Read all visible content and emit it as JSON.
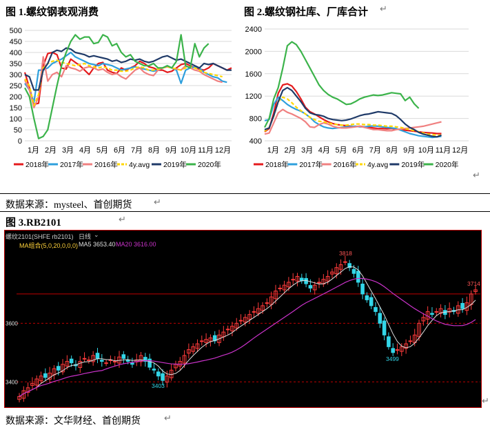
{
  "fig1": {
    "title": "图 1.螺纹钢表观消费",
    "months": [
      "1月",
      "2月",
      "3月",
      "4月",
      "5月",
      "6月",
      "7月",
      "8月",
      "9月",
      "10月",
      "11月",
      "12月"
    ],
    "yticks": [
      "0",
      "50",
      "100",
      "150",
      "200",
      "250",
      "300",
      "350",
      "400",
      "450",
      "500"
    ],
    "series": [
      {
        "name": "2018年",
        "color": "#e41a1c",
        "dash": "",
        "values": [
          310,
          240,
          165,
          170,
          340,
          395,
          400,
          390,
          330,
          325,
          370,
          355,
          340,
          320,
          300,
          330,
          350,
          355,
          320,
          310,
          305,
          330,
          320,
          330,
          340,
          360,
          350,
          335,
          330,
          320,
          320,
          310,
          315,
          330,
          345,
          350,
          340,
          330,
          325,
          320,
          330,
          350,
          340,
          330,
          320,
          330
        ]
      },
      {
        "name": "2017年",
        "color": "#2e9fdc",
        "dash": "",
        "values": [
          260,
          230,
          175,
          320,
          320,
          330,
          350,
          360,
          370,
          385,
          400,
          380,
          370,
          360,
          350,
          345,
          340,
          350,
          345,
          340,
          330,
          320,
          325,
          330,
          335,
          330,
          325,
          320,
          315,
          320,
          330,
          340,
          330,
          320,
          260,
          320,
          330,
          335,
          330,
          310,
          300,
          290,
          285,
          270,
          265
        ]
      },
      {
        "name": "2016年",
        "color": "#f08080",
        "dash": "",
        "values": [
          275,
          230,
          150,
          200,
          380,
          270,
          300,
          310,
          290,
          340,
          330,
          325,
          315,
          330,
          335,
          330,
          320,
          325,
          310,
          300,
          305,
          290,
          280,
          300,
          320,
          330,
          310,
          300,
          295,
          320,
          330,
          335,
          330,
          325,
          320,
          340,
          330,
          320,
          315,
          300,
          290,
          280,
          270,
          265
        ]
      },
      {
        "name": "4y.avg",
        "color": "#ffd700",
        "dash": "5,3",
        "values": [
          280,
          250,
          160,
          210,
          330,
          350,
          360,
          365,
          355,
          350,
          345,
          340,
          345,
          350,
          340,
          335,
          330,
          335,
          330,
          320,
          320,
          315,
          315,
          320,
          330,
          335,
          330,
          320,
          320,
          325,
          330,
          335,
          330,
          325,
          320,
          330,
          335,
          330,
          320,
          310,
          305,
          300,
          295,
          290
        ]
      },
      {
        "name": "2019年",
        "color": "#1f3a68",
        "dash": "",
        "values": [
          300,
          290,
          230,
          230,
          320,
          350,
          400,
          410,
          405,
          420,
          415,
          400,
          395,
          390,
          380,
          385,
          380,
          375,
          370,
          360,
          365,
          355,
          360,
          370,
          365,
          370,
          360,
          355,
          360,
          370,
          380,
          385,
          375,
          365,
          370,
          360,
          350,
          340,
          330,
          350,
          345,
          350,
          340,
          330,
          320,
          320
        ]
      },
      {
        "name": "2020年",
        "color": "#3bb34a",
        "dash": "",
        "values": [
          240,
          200,
          100,
          10,
          20,
          50,
          150,
          250,
          340,
          400,
          450,
          480,
          460,
          470,
          470,
          440,
          445,
          480,
          470,
          430,
          440,
          400,
          380,
          390,
          360,
          350,
          340,
          340,
          350,
          330,
          330,
          340,
          330,
          360,
          480,
          340,
          330,
          440,
          380,
          420,
          440
        ]
      }
    ]
  },
  "fig2": {
    "title": "图 2.螺纹钢社库、厂库合计",
    "months": [
      "1月",
      "2月",
      "3月",
      "4月",
      "5月",
      "6月",
      "7月",
      "8月",
      "9月",
      "10月",
      "11月",
      "12月"
    ],
    "yticks": [
      "400",
      "800",
      "1200",
      "1600",
      "2000",
      "2400"
    ],
    "series": [
      {
        "name": "2018年",
        "color": "#e41a1c",
        "dash": "",
        "values": [
          560,
          620,
          900,
          1250,
          1400,
          1420,
          1380,
          1280,
          1150,
          1000,
          920,
          880,
          830,
          780,
          740,
          710,
          690,
          680,
          670,
          660,
          655,
          660,
          650,
          640,
          630,
          620,
          620,
          615,
          620,
          610,
          600,
          590,
          580,
          570,
          560,
          550,
          545,
          540,
          530,
          530
        ]
      },
      {
        "name": "2017年",
        "color": "#2e9fdc",
        "dash": "",
        "values": [
          760,
          780,
          1050,
          1180,
          1120,
          1050,
          1000,
          960,
          930,
          880,
          820,
          740,
          690,
          650,
          630,
          620,
          630,
          640,
          650,
          655,
          660,
          650,
          650,
          660,
          665,
          660,
          650,
          640,
          630,
          620,
          590,
          560,
          530,
          510,
          490,
          480,
          470,
          460,
          470,
          480
        ]
      },
      {
        "name": "2016年",
        "color": "#f08080",
        "dash": "",
        "values": [
          520,
          540,
          720,
          900,
          960,
          910,
          880,
          840,
          800,
          740,
          650,
          640,
          690,
          720,
          700,
          660,
          640,
          630,
          630,
          640,
          650,
          660,
          640,
          620,
          600,
          600,
          590,
          580,
          580,
          600,
          610,
          620,
          630,
          640,
          650,
          660,
          680,
          700,
          720,
          740
        ]
      },
      {
        "name": "4y.avg",
        "color": "#ffd700",
        "dash": "5,3",
        "values": [
          570,
          640,
          840,
          1100,
          1180,
          1150,
          1080,
          1000,
          940,
          880,
          820,
          780,
          750,
          740,
          720,
          700,
          690,
          680,
          680,
          690,
          700,
          700,
          690,
          690,
          680,
          680,
          670,
          660,
          660,
          650,
          640,
          620,
          600,
          580,
          560,
          540,
          520,
          510,
          500,
          500
        ]
      },
      {
        "name": "2019年",
        "color": "#1f3a68",
        "dash": "",
        "values": [
          600,
          630,
          850,
          1100,
          1300,
          1350,
          1300,
          1200,
          1100,
          980,
          900,
          870,
          860,
          840,
          800,
          780,
          770,
          760,
          770,
          790,
          820,
          850,
          870,
          880,
          900,
          920,
          910,
          900,
          890,
          850,
          780,
          700,
          640,
          600,
          550,
          520,
          500,
          480,
          470,
          500
        ]
      },
      {
        "name": "2020年",
        "color": "#3bb34a",
        "dash": "",
        "values": [
          640,
          800,
          1150,
          1350,
          1700,
          2100,
          2170,
          2120,
          2000,
          1850,
          1700,
          1550,
          1400,
          1300,
          1230,
          1180,
          1150,
          1100,
          1050,
          1060,
          1100,
          1150,
          1180,
          1200,
          1220,
          1210,
          1220,
          1240,
          1260,
          1250,
          1240,
          1120,
          1180,
          1060,
          980
        ]
      }
    ]
  },
  "source1": "数据来源：mysteel、首创期货",
  "fig3": {
    "title": "图 3.RB2101",
    "header": {
      "contract": "螺纹2101(SHFE rb2101)",
      "period": "日线",
      "ma_combo": "MA组合(5,0,20,0,0,0)",
      "ma5": "MA5 3653.40",
      "ma20": "MA20 3616.00"
    },
    "yticks": [
      "3400",
      "3600"
    ],
    "annotations": [
      "3818",
      "3714",
      "3403",
      "3499"
    ],
    "colors": {
      "up": "#ff3b3b",
      "down": "#33d6e8",
      "ma5": "#e0e0e0",
      "ma20": "#cc33cc",
      "grid": "#c00000",
      "label": "#33d6e8"
    }
  },
  "source2": "数据来源：文华财经、首创期货"
}
